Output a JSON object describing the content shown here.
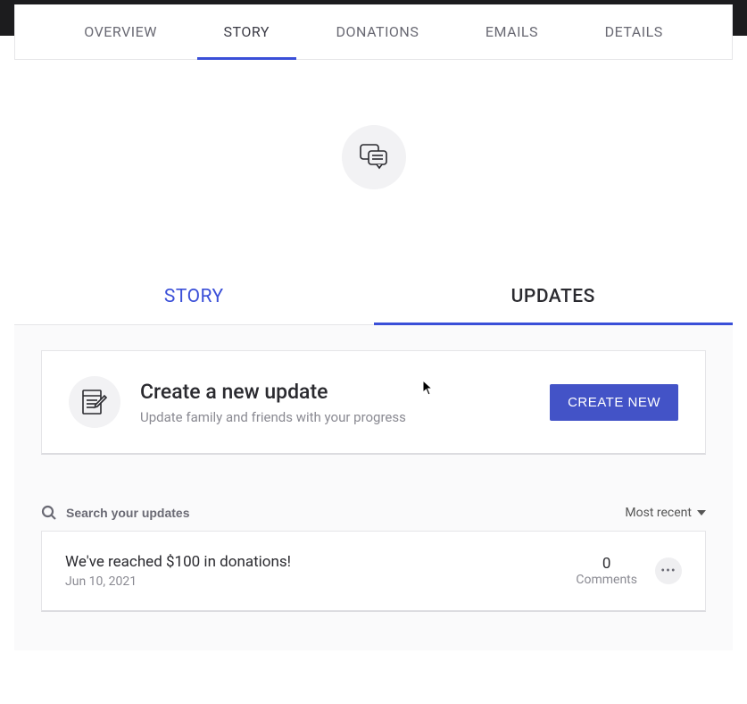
{
  "topTabs": {
    "overview": "OVERVIEW",
    "story": "STORY",
    "donations": "DONATIONS",
    "emails": "EMAILS",
    "details": "DETAILS"
  },
  "subTabs": {
    "story": "STORY",
    "updates": "UPDATES"
  },
  "createCard": {
    "title": "Create a new update",
    "subtitle": "Update family and friends with your progress",
    "button": "CREATE NEW"
  },
  "search": {
    "placeholder": "Search your updates"
  },
  "sort": {
    "label": "Most recent"
  },
  "updateItem": {
    "title": "We've reached $100 in donations!",
    "date": "Jun 10, 2021",
    "count": "0",
    "commentsLabel": "Comments"
  },
  "colors": {
    "accent": "#3a4fd8",
    "buttonBg": "#4353c7"
  }
}
